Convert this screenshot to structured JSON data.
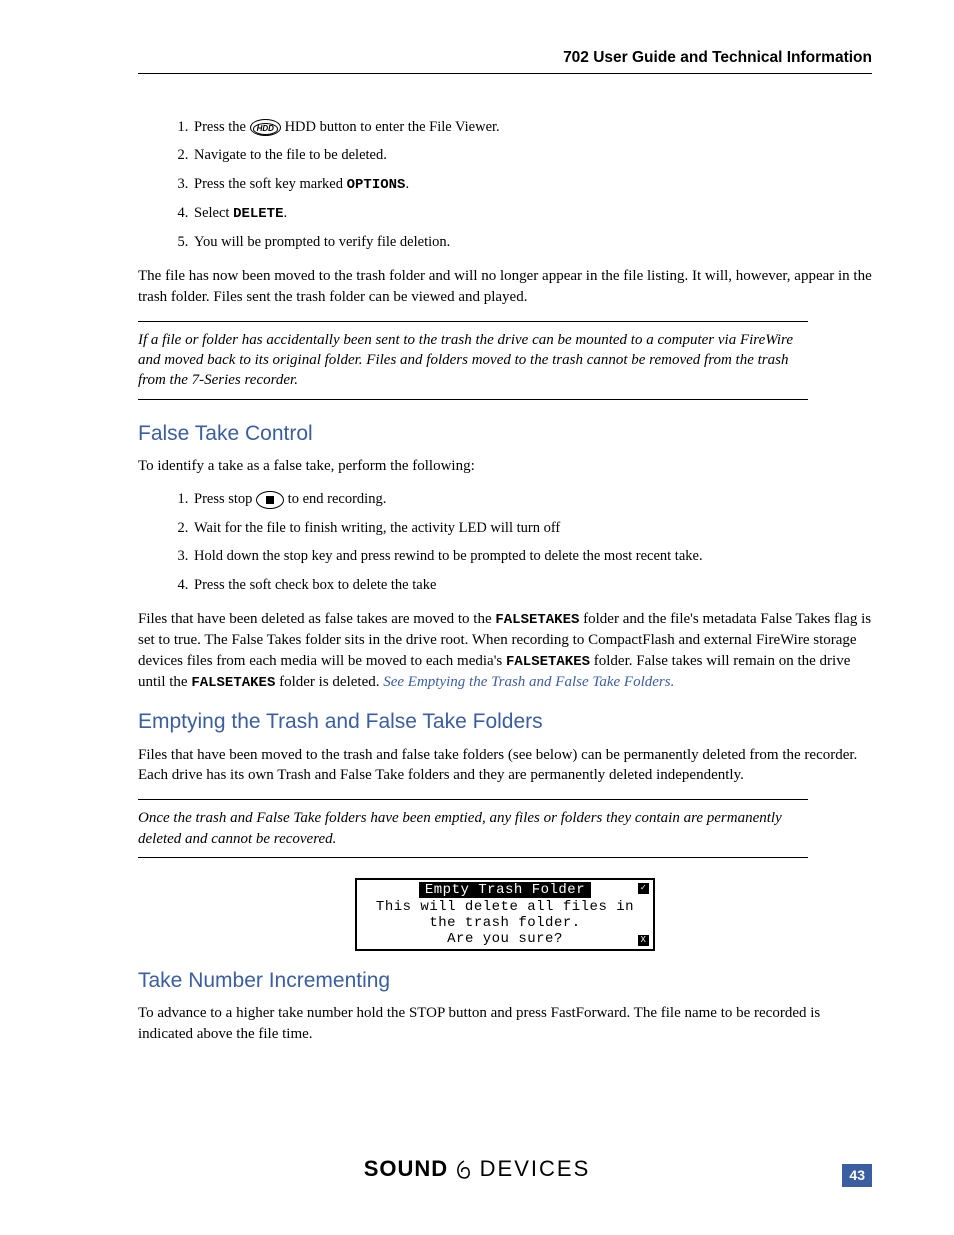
{
  "header": {
    "title": "702 User Guide and Technical Information"
  },
  "delete_steps": {
    "s1a": "Press the ",
    "hdd": "HDD",
    "s1b": " HDD button to enter the File Viewer.",
    "s2": "Navigate to the file to be deleted.",
    "s3a": "Press the soft key marked ",
    "s3b": "OPTIONS",
    "s3c": ".",
    "s4a": "Select ",
    "s4b": "DELETE",
    "s4c": ".",
    "s5": "You will be prompted to verify file deletion."
  },
  "p_after_delete": "The file has now been moved to the trash folder and will no longer appear in the file listing. It will, however, appear in the trash folder. Files sent the trash folder can be viewed and played.",
  "callout1": "If a file or folder has accidentally been sent to the trash the drive can be mounted to a computer via FireWire and moved back to its original folder. Files and folders moved to the trash cannot be removed from the trash from the 7-Series recorder.",
  "h_false": "False Take Control",
  "p_false_intro": "To identify a take as a false take, perform the following:",
  "false_steps": {
    "s1a": "Press stop ",
    "s1b": " to end recording.",
    "s2": "Wait for the file to finish writing, the activity LED will turn off",
    "s3": "Hold down the stop key and press rewind to be prompted to delete the most recent take.",
    "s4": "Press the soft check box to delete the take"
  },
  "p_false_body_a": "Files that have been deleted as false takes are moved to the ",
  "p_false_body_b": "FALSETAKES",
  "p_false_body_c": " folder and the file's metadata False Takes flag is set to true. The False Takes folder sits in the drive root. When recording to CompactFlash and external FireWire storage devices files from each media will be moved to each media's ",
  "p_false_body_d": "FALSETAKES",
  "p_false_body_e": " folder. False takes will remain on the drive until the ",
  "p_false_body_f": "FALSETAKES",
  "p_false_body_g": " folder is deleted. ",
  "p_false_link": "See Emptying the Trash and False Take Folders.",
  "h_empty": "Emptying the Trash and False Take Folders",
  "p_empty": "Files that have been moved to the trash and false take folders (see below) can be permanently deleted from the recorder. Each drive has its own Trash and False Take folders and they are permanently deleted independently.",
  "callout2": "Once the trash and False Take folders have been emptied, any files or folders they contain are permanently deleted and cannot be recovered.",
  "lcd": {
    "title": "Empty Trash Folder",
    "l1": "This will delete all files in",
    "l2": "the trash folder.",
    "l3": "Are you sure?",
    "check": "✓",
    "x": "X"
  },
  "h_take": "Take Number Incrementing",
  "p_take": "To advance to a higher take number hold the STOP button and press FastForward. The file name to be recorded is indicated above the file time.",
  "footer": {
    "sound": "SOUND",
    "devices": "DEVICES",
    "page": "43"
  }
}
